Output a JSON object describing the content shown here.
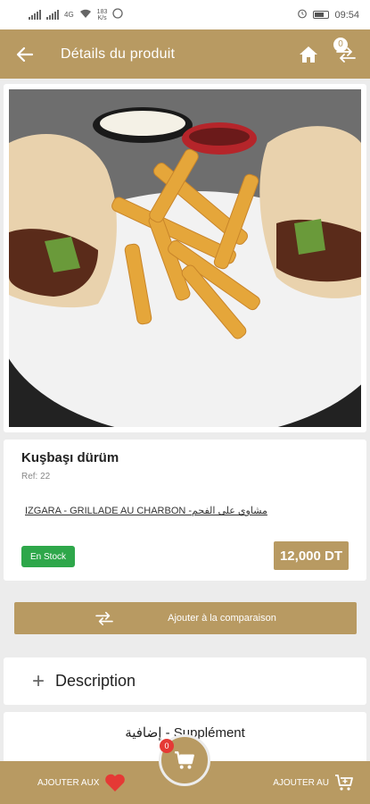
{
  "status_bar": {
    "network": "4G",
    "speed_value": "183",
    "speed_unit": "K/s",
    "time": "09:54"
  },
  "header": {
    "title": "Détails du produit",
    "compare_count": "0"
  },
  "product": {
    "name": "Kuşbaşı dürüm",
    "ref": "Ref: 22",
    "category": "IZGARA - GRILLADE AU CHARBON -مشاوي على الفحم",
    "stock": "En Stock",
    "price": "12,000 DT",
    "image_alt": "Kuşbaşı dürüm"
  },
  "actions": {
    "compare_label": "Ajouter à la comparaison",
    "description_label": "Description",
    "supplement_title": "إضافية - Supplément"
  },
  "bottom_bar": {
    "favorites_label": "AJOUTER AUX",
    "cart_label": "AJOUTER AU",
    "cart_count": "0"
  },
  "colors": {
    "brand": "#b89a62",
    "stock": "#2ea74a",
    "badge": "#e53935"
  },
  "icons": [
    "back-arrow-icon",
    "home-icon",
    "compare-icon",
    "plus-icon",
    "heart-icon",
    "cart-icon"
  ]
}
